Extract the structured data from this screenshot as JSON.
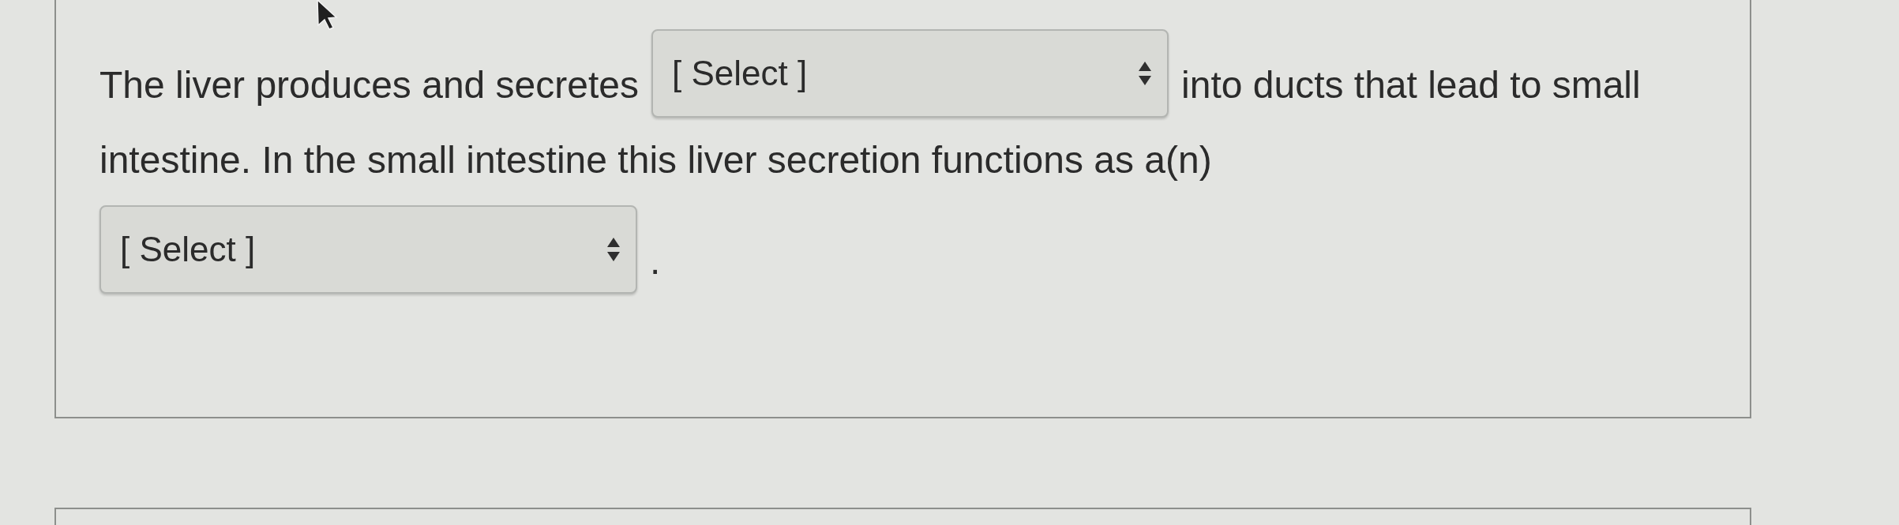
{
  "question": {
    "lines": [
      [
        {
          "kind": "text",
          "text": "The liver produces and secretes"
        },
        {
          "kind": "select",
          "value": "[ Select ]"
        },
        {
          "kind": "text",
          "text": "into ducts that lead to small"
        }
      ],
      [
        {
          "kind": "text",
          "text": "intestine. In the small intestine this liver secretion functions as a(n)"
        }
      ],
      [
        {
          "kind": "select",
          "value": "[ Select ]"
        },
        {
          "kind": "text",
          "text": "."
        }
      ]
    ]
  }
}
